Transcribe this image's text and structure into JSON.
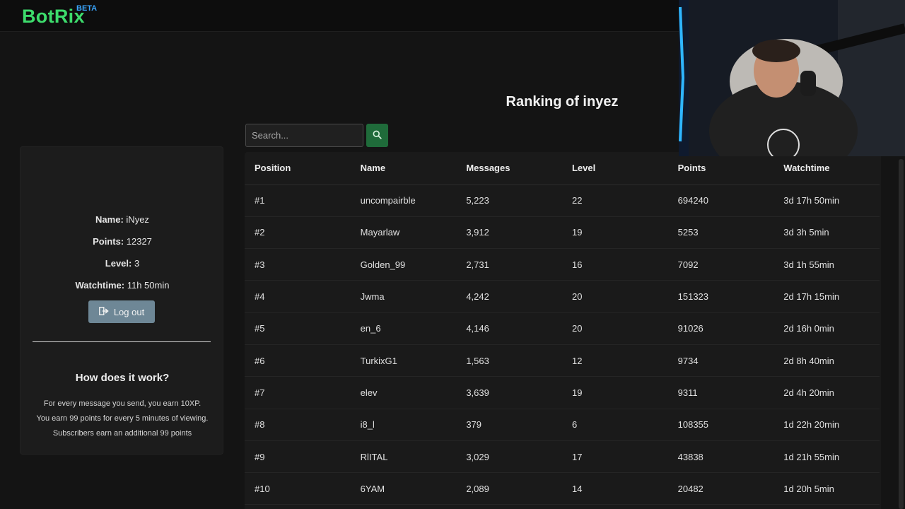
{
  "brand": {
    "name": "BotRix",
    "badge": "BETA"
  },
  "page_title": "Ranking of inyez",
  "search": {
    "placeholder": "Search..."
  },
  "profile": {
    "name_label": "Name:",
    "name_value": "iNyez",
    "points_label": "Points:",
    "points_value": "12327",
    "level_label": "Level:",
    "level_value": "3",
    "watchtime_label": "Watchtime:",
    "watchtime_value": "11h 50min",
    "logout_label": "Log out"
  },
  "how": {
    "title": "How does it work?",
    "lines": [
      "For every message you send, you earn 10XP.",
      "You earn 99 points for every 5 minutes of viewing.",
      "Subscribers earn an additional 99 points"
    ]
  },
  "table": {
    "headers": [
      "Position",
      "Name",
      "Messages",
      "Level",
      "Points",
      "Watchtime"
    ],
    "rows": [
      [
        "#1",
        "uncompairble",
        "5,223",
        "22",
        "694240",
        "3d 17h 50min"
      ],
      [
        "#2",
        "Mayarlaw",
        "3,912",
        "19",
        "5253",
        "3d 3h 5min"
      ],
      [
        "#3",
        "Golden_99",
        "2,731",
        "16",
        "7092",
        "3d 1h 55min"
      ],
      [
        "#4",
        "Jwma",
        "4,242",
        "20",
        "151323",
        "2d 17h 15min"
      ],
      [
        "#5",
        "en_6",
        "4,146",
        "20",
        "91026",
        "2d 16h 0min"
      ],
      [
        "#6",
        "TurkixG1",
        "1,563",
        "12",
        "9734",
        "2d 8h 40min"
      ],
      [
        "#7",
        "elev",
        "3,639",
        "19",
        "9311",
        "2d 4h 20min"
      ],
      [
        "#8",
        "i8_l",
        "379",
        "6",
        "108355",
        "1d 22h 20min"
      ],
      [
        "#9",
        "RlITAL",
        "3,029",
        "17",
        "43838",
        "1d 21h 55min"
      ],
      [
        "#10",
        "6YAM",
        "2,089",
        "14",
        "20482",
        "1d 20h 5min"
      ]
    ]
  },
  "colors": {
    "brand": "#3ddc6c",
    "badge": "#3ba7ff",
    "search_button": "#1f6b3a",
    "logout_button": "#6e8796"
  }
}
